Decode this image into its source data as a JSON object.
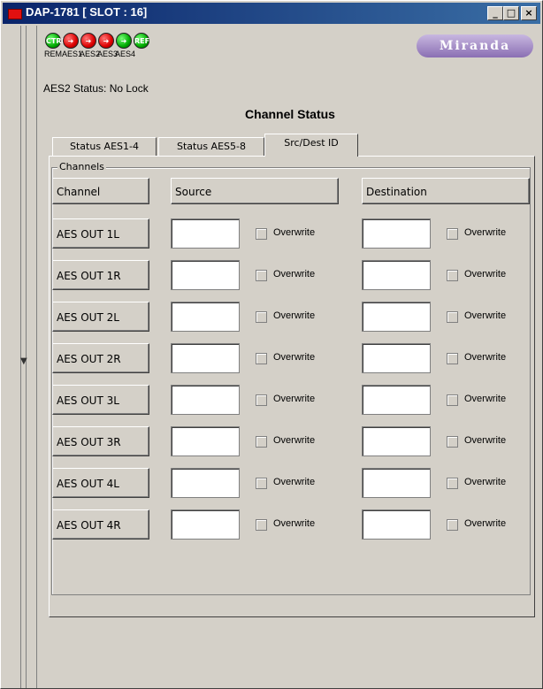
{
  "window": {
    "title": "DAP-1781 [ SLOT : 16]"
  },
  "leds": [
    {
      "text": "CTRL",
      "label": "REM",
      "color": "green"
    },
    {
      "text": "",
      "label": "AES1",
      "color": "red"
    },
    {
      "text": "",
      "label": "AES2",
      "color": "red"
    },
    {
      "text": "",
      "label": "AES3",
      "color": "red"
    },
    {
      "text": "",
      "label": "AES4",
      "color": "green"
    },
    {
      "text": "REF",
      "label": "",
      "color": "green"
    }
  ],
  "logo": "Miranda",
  "aes_status": "AES2 Status: No Lock",
  "section_title": "Channel Status",
  "tabs": [
    "Status AES1-4",
    "Status AES5-8",
    "Src/Dest ID"
  ],
  "group": {
    "legend": "Channels",
    "headers": [
      "Channel",
      "Source",
      "Destination"
    ],
    "overwrite_label": "Overwrite",
    "rows": [
      "AES OUT 1L",
      "AES OUT 1R",
      "AES OUT 2L",
      "AES OUT 2R",
      "AES OUT 3L",
      "AES OUT 3R",
      "AES OUT 4L",
      "AES OUT 4R"
    ]
  }
}
